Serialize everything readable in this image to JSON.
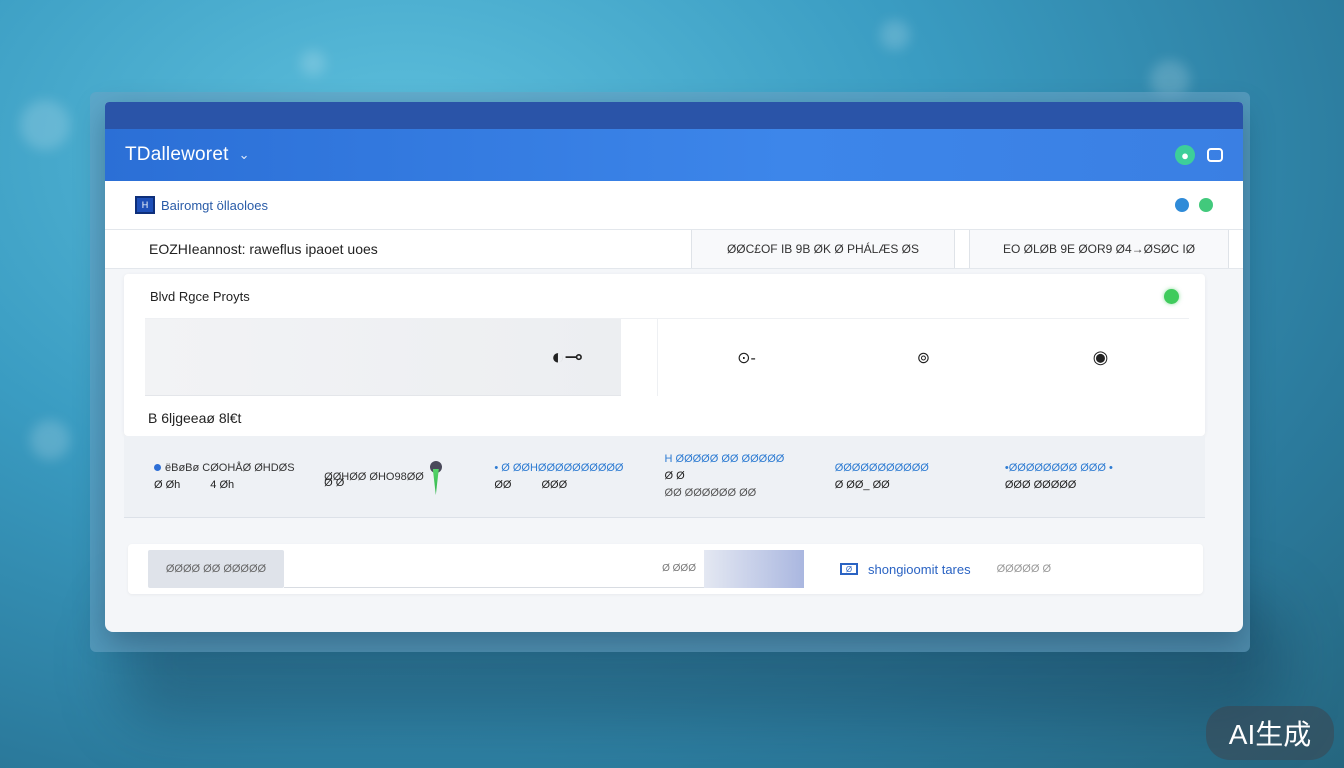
{
  "app": {
    "title": "TDalleworet",
    "chevron": "⌄"
  },
  "subheader": {
    "label": "Bairomgt öllaoloes",
    "badge": "H"
  },
  "info_row": {
    "main": "EOZHIeannost: raweflus ipaoet uoes",
    "cells": [
      "ØØC£OF IB 9B ØK Ø PHÁLÆS ØS",
      "EO ØLØB 9E ØOR9 Ø4→ØSØC IØ"
    ]
  },
  "panel": {
    "title": "Blvd Rgce Proyts",
    "knobs": [
      "◐⊸",
      "⊙-",
      "⊚",
      "◉"
    ],
    "section_title": "B 6ljgeeaø 8l€t"
  },
  "metrics": [
    {
      "label": "ëBøBø CØOHÅØ ØHDØS",
      "values": [
        "Ø Øh",
        "4 Øh"
      ],
      "bullet": true
    },
    {
      "label": "ØØHØØ ØHO98ØØ",
      "values": [
        "Ø Ø"
      ],
      "marker": true
    },
    {
      "label": "• Ø ØØHØØØØØØØØØØ",
      "values": [
        "ØØ",
        "ØØØ"
      ],
      "blue": true
    },
    {
      "label": "H ØØØØØ ØØ ØØØØØ",
      "values": [
        "Ø Ø"
      ],
      "extra": "ØØ ØØØØØØ ØØ",
      "blue": true
    },
    {
      "label": "ØØØØØØØØØØØ",
      "values": [
        "Ø ØØ_ ØØ"
      ]
    },
    {
      "label": "•ØØØØØØØØ ØØØ •",
      "values": [
        "ØØØ ØØØØØ"
      ],
      "blue": true
    }
  ],
  "bottom_bar": {
    "button": "ØØØØ ØØ ØØØØØ",
    "input_hint": "Ø ØØØ",
    "link_icon": "Ø",
    "link": "shongioomit tares",
    "aux": "ØØØØØ Ø"
  },
  "watermark": "AI生成",
  "colors": {
    "accent": "#2b6fd6",
    "status": "#3fcb5c"
  }
}
